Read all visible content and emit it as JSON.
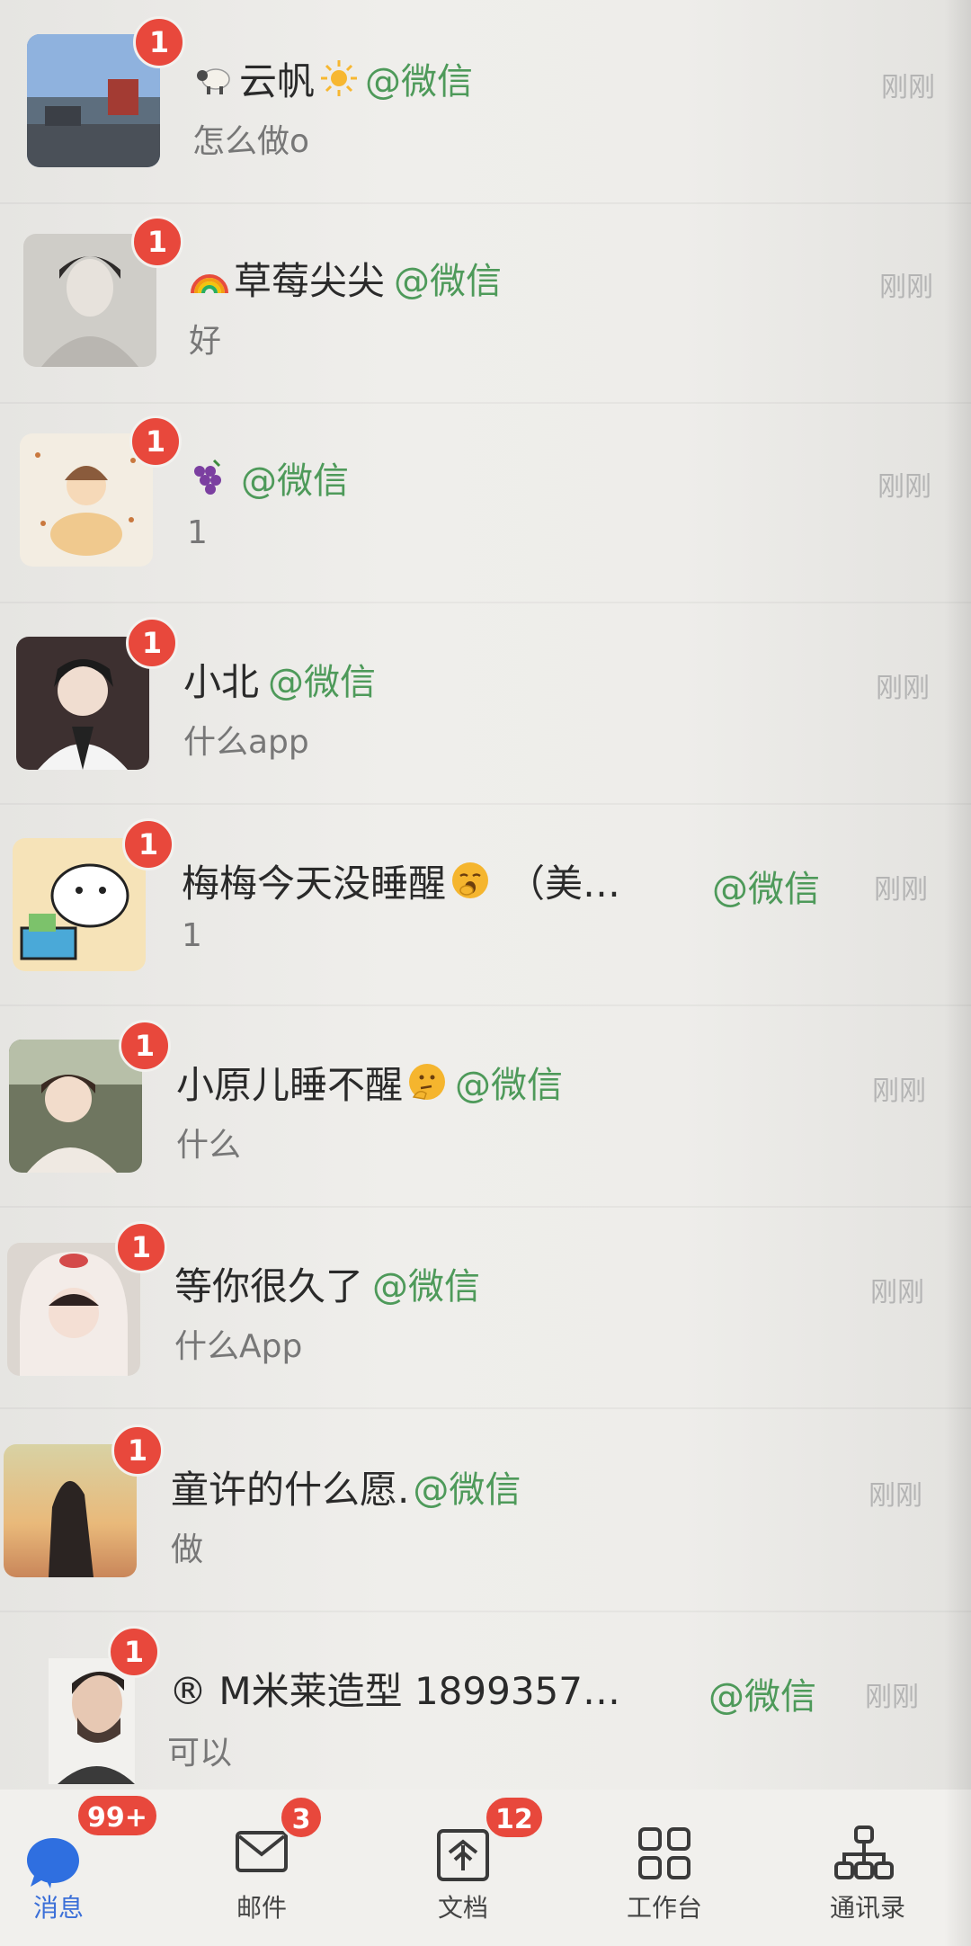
{
  "chats": [
    {
      "name": "云帆",
      "handle": "@微信",
      "preview": "怎么做o",
      "time": "刚刚",
      "badge": "1",
      "emoji_prefix": "sheep-emoji",
      "emoji_suffix": "sun-emoji"
    },
    {
      "name": "草莓尖尖",
      "handle": "@微信",
      "preview": "好",
      "time": "刚刚",
      "badge": "1",
      "emoji_prefix": "rainbow-emoji"
    },
    {
      "name": "",
      "handle": "@微信",
      "preview": "1",
      "time": "刚刚",
      "badge": "1",
      "emoji_prefix": "grapes-emoji"
    },
    {
      "name": "小北",
      "handle": "@微信",
      "preview": "什么app",
      "time": "刚刚",
      "badge": "1"
    },
    {
      "name": "梅梅今天没睡醒",
      "name_suffix": "（美…",
      "handle": "@微信",
      "preview": "1",
      "time": "刚刚",
      "badge": "1",
      "emoji_suffix": "yawning-face-emoji"
    },
    {
      "name": "小原儿睡不醒",
      "handle": "@微信",
      "preview": "什么",
      "time": "刚刚",
      "badge": "1",
      "emoji_suffix": "thinking-face-emoji"
    },
    {
      "name": "等你很久了",
      "handle": "@微信",
      "preview": "什么App",
      "time": "刚刚",
      "badge": "1"
    },
    {
      "name": "童许的什么愿.",
      "handle": "@微信",
      "preview": "做",
      "time": "刚刚",
      "badge": "1"
    },
    {
      "name": "® M米莱造型 1899357…",
      "handle": "@微信",
      "preview": "可以",
      "time": "刚刚",
      "badge": "1"
    }
  ],
  "tabbar": {
    "tabs": [
      {
        "label": "消息",
        "badge": "99+",
        "icon": "message-bubble-icon",
        "active": true
      },
      {
        "label": "邮件",
        "badge": "3",
        "icon": "envelope-icon"
      },
      {
        "label": "文档",
        "badge": "12",
        "icon": "document-icon"
      },
      {
        "label": "工作台",
        "badge": "",
        "icon": "grid-apps-icon"
      },
      {
        "label": "通讯录",
        "badge": "",
        "icon": "org-chart-icon"
      }
    ]
  },
  "colors": {
    "badge": "#e8483c",
    "handle": "#4e9a5a",
    "active_tab": "#3b6fd8"
  }
}
